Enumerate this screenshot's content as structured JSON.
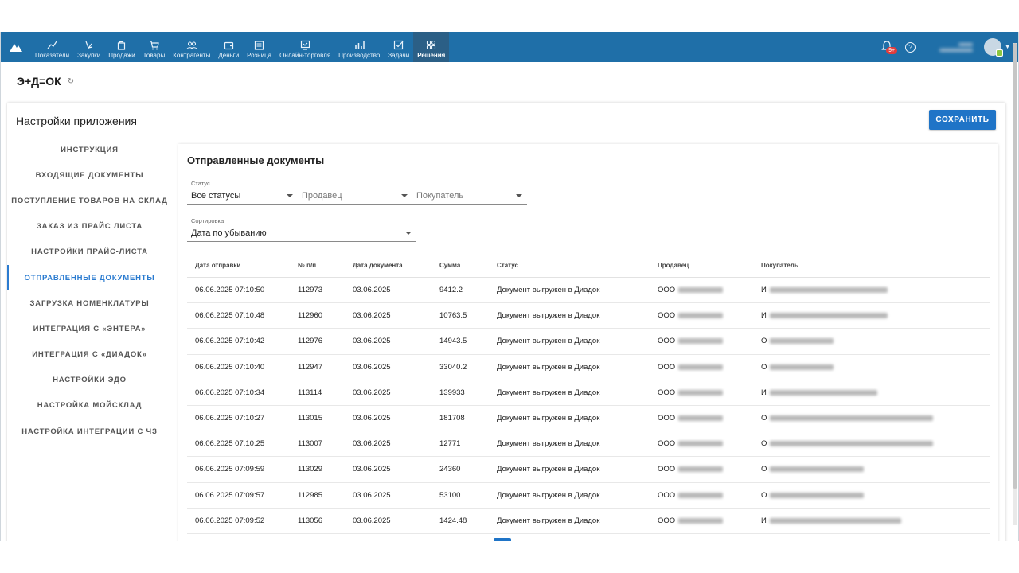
{
  "nav": {
    "items": [
      {
        "label": "Показатели",
        "icon": "chart-line-icon"
      },
      {
        "label": "Закупки",
        "icon": "purchase-icon"
      },
      {
        "label": "Продажи",
        "icon": "bag-icon"
      },
      {
        "label": "Товары",
        "icon": "cart-icon"
      },
      {
        "label": "Контрагенты",
        "icon": "people-icon"
      },
      {
        "label": "Деньги",
        "icon": "wallet-icon"
      },
      {
        "label": "Розница",
        "icon": "register-icon"
      },
      {
        "label": "Онлайн-торговля",
        "icon": "online-store-icon"
      },
      {
        "label": "Производство",
        "icon": "bars-icon"
      },
      {
        "label": "Задачи",
        "icon": "checkbox-icon"
      },
      {
        "label": "Решения",
        "icon": "apps-icon"
      }
    ],
    "notifications_badge": "9+",
    "help_symbol": "?"
  },
  "app": {
    "name": "Э+Д=ОК",
    "refresh_symbol": "↻"
  },
  "page": {
    "title": "Настройки приложения",
    "save_label": "СОХРАНИТЬ"
  },
  "sidebar": {
    "items": [
      "ИНСТРУКЦИЯ",
      "ВХОДЯЩИЕ ДОКУМЕНТЫ",
      "ПОСТУПЛЕНИЕ ТОВАРОВ НА СКЛАД",
      "ЗАКАЗ ИЗ ПРАЙС ЛИСТА",
      "НАСТРОЙКИ ПРАЙС-ЛИСТА",
      "ОТПРАВЛЕННЫЕ ДОКУМЕНТЫ",
      "ЗАГРУЗКА НОМЕНКЛАТУРЫ",
      "ИНТЕГРАЦИЯ С «ЭНТЕРА»",
      "ИНТЕГРАЦИЯ С «ДИАДОК»",
      "НАСТРОЙКИ ЭДО",
      "НАСТРОЙКА МОЙСКЛАД",
      "НАСТРОЙКА ИНТЕГРАЦИИ С ЧЗ"
    ],
    "active_index": 5
  },
  "content": {
    "title": "Отправленные документы",
    "filters": {
      "status_label": "Статус",
      "status_value": "Все статусы",
      "seller_placeholder": "Продавец",
      "buyer_placeholder": "Покупатель",
      "sort_label": "Сортировка",
      "sort_value": "Дата по убыванию"
    },
    "columns": [
      "Дата отправки",
      "№ п/п",
      "Дата документа",
      "Сумма",
      "Статус",
      "Продавец",
      "Покупатель"
    ],
    "rows": [
      {
        "sent": "06.06.2025 07:10:50",
        "num": "112973",
        "doc_date": "03.06.2025",
        "sum": "9412.2",
        "status": "Документ выгружен в Диадок",
        "seller": "ООО",
        "buyer": "И"
      },
      {
        "sent": "06.06.2025 07:10:48",
        "num": "112960",
        "doc_date": "03.06.2025",
        "sum": "10763.5",
        "status": "Документ выгружен в Диадок",
        "seller": "ООО",
        "buyer": "И"
      },
      {
        "sent": "06.06.2025 07:10:42",
        "num": "112976",
        "doc_date": "03.06.2025",
        "sum": "14943.5",
        "status": "Документ выгружен в Диадок",
        "seller": "ООО",
        "buyer": "О"
      },
      {
        "sent": "06.06.2025 07:10:40",
        "num": "112947",
        "doc_date": "03.06.2025",
        "sum": "33040.2",
        "status": "Документ выгружен в Диадок",
        "seller": "ООО",
        "buyer": "О"
      },
      {
        "sent": "06.06.2025 07:10:34",
        "num": "113114",
        "doc_date": "03.06.2025",
        "sum": "139933",
        "status": "Документ выгружен в Диадок",
        "seller": "ООО",
        "buyer": "И"
      },
      {
        "sent": "06.06.2025 07:10:27",
        "num": "113015",
        "doc_date": "03.06.2025",
        "sum": "181708",
        "status": "Документ выгружен в Диадок",
        "seller": "ООО",
        "buyer": "О"
      },
      {
        "sent": "06.06.2025 07:10:25",
        "num": "113007",
        "doc_date": "03.06.2025",
        "sum": "12771",
        "status": "Документ выгружен в Диадок",
        "seller": "ООО",
        "buyer": "О"
      },
      {
        "sent": "06.06.2025 07:09:59",
        "num": "113029",
        "doc_date": "03.06.2025",
        "sum": "24360",
        "status": "Документ выгружен в Диадок",
        "seller": "ООО",
        "buyer": "О"
      },
      {
        "sent": "06.06.2025 07:09:57",
        "num": "112985",
        "doc_date": "03.06.2025",
        "sum": "53100",
        "status": "Документ выгружен в Диадок",
        "seller": "ООО",
        "buyer": "О"
      },
      {
        "sent": "06.06.2025 07:09:52",
        "num": "113056",
        "doc_date": "03.06.2025",
        "sum": "1424.48",
        "status": "Документ выгружен в Диадок",
        "seller": "ООО",
        "buyer": "И"
      }
    ]
  },
  "colors": {
    "topbar": "#1f6fa8",
    "accent": "#1f74c7",
    "active_nav": "#2b5f86"
  }
}
